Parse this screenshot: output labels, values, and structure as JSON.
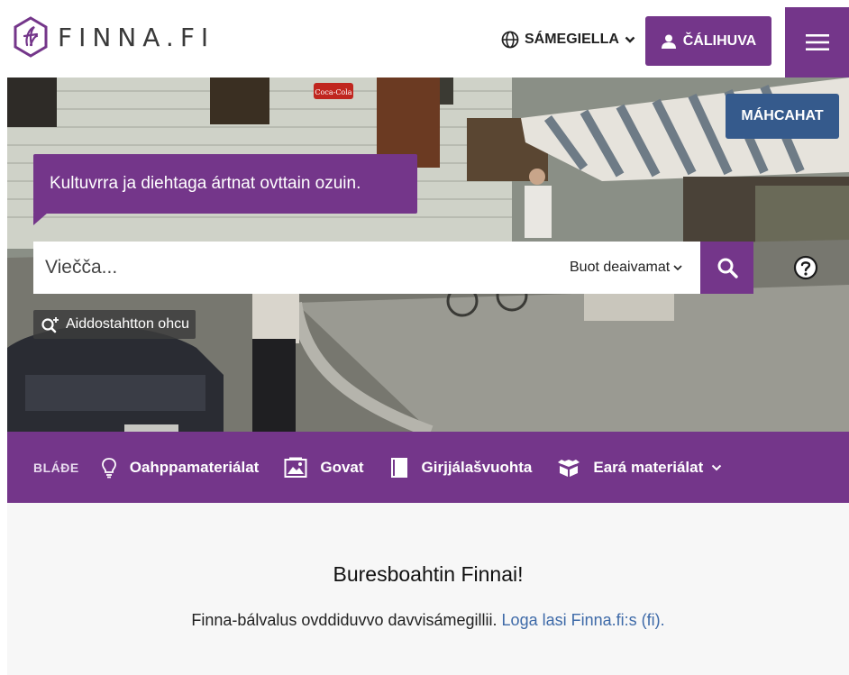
{
  "header": {
    "logo_text": "FINNA.FI",
    "language_label": "SÁMEGIELLA",
    "login_label": "ČÁLIHUVA"
  },
  "hero": {
    "news_label": "MÁHCAHAT",
    "tagline": "Kultuvrra ja diehtaga ártnat ovttain ozuin.",
    "search_placeholder": "Viečča...",
    "search_scope": "Buot deaivamat",
    "advanced_search_label": "Aiddostahtton ohcu",
    "sign_text": "Coca-Cola"
  },
  "browse": {
    "label": "BLÁĐE",
    "items": [
      {
        "label": "Oahppamateriálat",
        "icon": "lightbulb-icon"
      },
      {
        "label": "Govat",
        "icon": "image-icon"
      },
      {
        "label": "Girjjálašvuohta",
        "icon": "book-icon"
      },
      {
        "label": "Eará materiálat",
        "icon": "box-icon"
      }
    ]
  },
  "welcome": {
    "title": "Buresboahtin Finnai!",
    "text": "Finna-bálvalus ovddiduvvo davvisámegillii.",
    "link": "Loga lasi Finna.fi:s (fi)."
  },
  "colors": {
    "brand_purple": "#74368a",
    "news_blue": "#355a8c",
    "link_blue": "#3e6aa8"
  }
}
